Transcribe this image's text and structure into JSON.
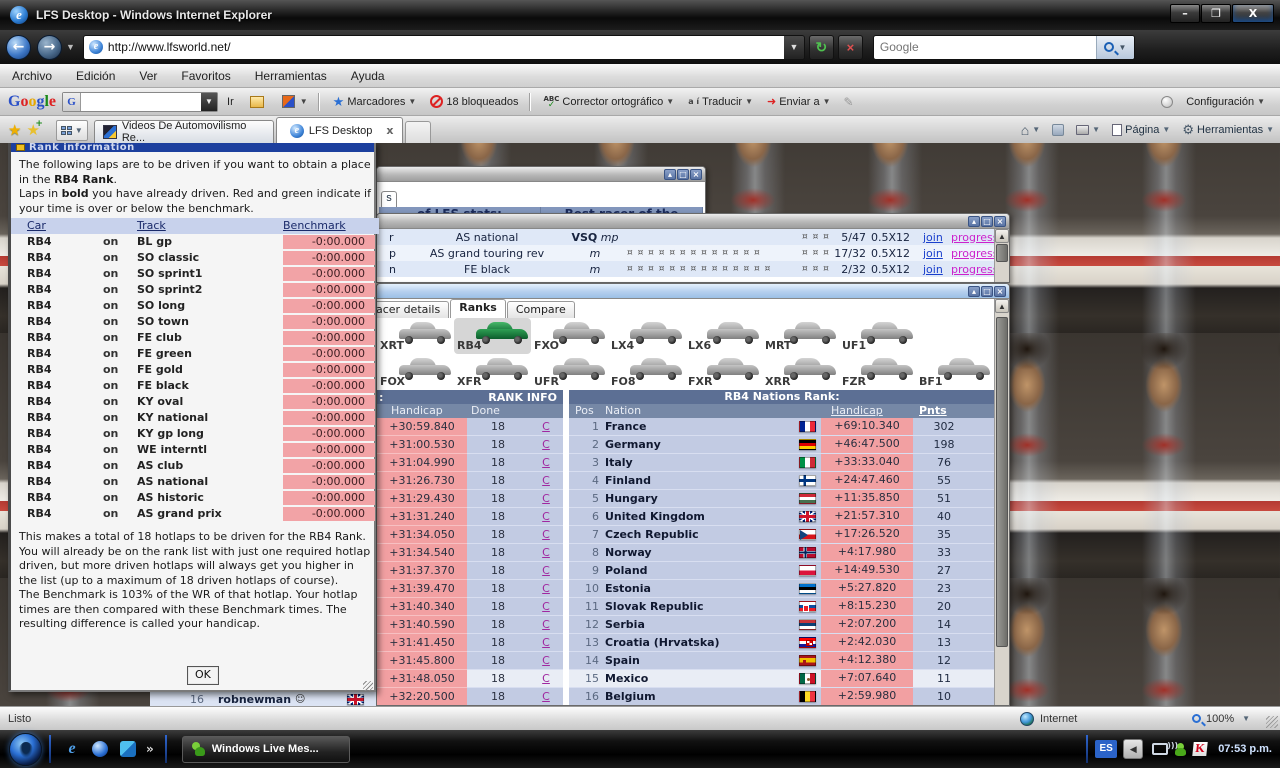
{
  "window": {
    "title": "LFS Desktop - Windows Internet Explorer"
  },
  "address_bar": {
    "url": "http://www.lfsworld.net/",
    "search_placeholder": "Google"
  },
  "menu_bar": {
    "items": [
      "Archivo",
      "Edición",
      "Ver",
      "Favoritos",
      "Herramientas",
      "Ayuda"
    ]
  },
  "google_toolbar": {
    "logo": "Google",
    "go_label": "Ir",
    "bookmarks_label": "Marcadores",
    "blocked_label": "18 bloqueados",
    "spellcheck_label": "Corrector ortográfico",
    "translate_label": "Traducir",
    "send_label": "Enviar a",
    "settings_label": "Configuración"
  },
  "tab_bar": {
    "tab1": "Videos De Automovilismo Re...",
    "tab2": "LFS Desktop",
    "close_glyph": "x",
    "page_label": "Página",
    "tools_label": "Herramientas"
  },
  "rank_info_panel": {
    "title": "Rank information",
    "intro1_pre": "The following laps are to be driven if you want to obtain a place in the ",
    "intro1_bold": "RB4 Rank",
    "intro1_post": ".",
    "intro2_pre": "Laps in ",
    "intro2_bold": "bold",
    "intro2_post": " you have already driven. Red and green indicate if your time is over or below the benchmark.",
    "table": {
      "headers": [
        "Car",
        "Track",
        "Benchmark"
      ],
      "on_word": "on",
      "rows": [
        {
          "car": "RB4",
          "track": "BL gp",
          "benchmark": "-0:00.000"
        },
        {
          "car": "RB4",
          "track": "SO classic",
          "benchmark": "-0:00.000"
        },
        {
          "car": "RB4",
          "track": "SO sprint1",
          "benchmark": "-0:00.000"
        },
        {
          "car": "RB4",
          "track": "SO sprint2",
          "benchmark": "-0:00.000"
        },
        {
          "car": "RB4",
          "track": "SO long",
          "benchmark": "-0:00.000"
        },
        {
          "car": "RB4",
          "track": "SO town",
          "benchmark": "-0:00.000"
        },
        {
          "car": "RB4",
          "track": "FE club",
          "benchmark": "-0:00.000"
        },
        {
          "car": "RB4",
          "track": "FE green",
          "benchmark": "-0:00.000"
        },
        {
          "car": "RB4",
          "track": "FE gold",
          "benchmark": "-0:00.000"
        },
        {
          "car": "RB4",
          "track": "FE black",
          "benchmark": "-0:00.000"
        },
        {
          "car": "RB4",
          "track": "KY oval",
          "benchmark": "-0:00.000"
        },
        {
          "car": "RB4",
          "track": "KY national",
          "benchmark": "-0:00.000"
        },
        {
          "car": "RB4",
          "track": "KY gp long",
          "benchmark": "-0:00.000"
        },
        {
          "car": "RB4",
          "track": "WE interntl",
          "benchmark": "-0:00.000"
        },
        {
          "car": "RB4",
          "track": "AS club",
          "benchmark": "-0:00.000"
        },
        {
          "car": "RB4",
          "track": "AS national",
          "benchmark": "-0:00.000"
        },
        {
          "car": "RB4",
          "track": "AS historic",
          "benchmark": "-0:00.000"
        },
        {
          "car": "RB4",
          "track": "AS grand prix",
          "benchmark": "-0:00.000"
        }
      ]
    },
    "footer1": "This makes a total of 18 hotlaps to be driven for the RB4 Rank. You will already be on the rank list with just one required hotlap driven, but more driven hotlaps will always get you higher in the list (up to a maximum of 18 driven hotlaps of course).",
    "footer2": "The Benchmark is 103% of the WR of that hotlap. Your hotlap times are then compared with these Benchmark times. The resulting difference is called your handicap.",
    "ok_label": "OK"
  },
  "stats_window": {
    "tab": "s",
    "header_left": "of LFS stats:",
    "header_right": "Best racer of the moment:"
  },
  "hosts_window": {
    "rows": [
      {
        "letter": "r",
        "track": "AS national",
        "code": "VSQ",
        "mode": "mp",
        "cars_a": "",
        "cars_b": "¤ ¤ ¤",
        "count": "5/47",
        "grid": "0.5X12",
        "join_label": "join",
        "progress_label": "progress"
      },
      {
        "letter": "p",
        "track": "AS grand touring rev",
        "code": "",
        "mode": "m",
        "cars_a": "¤ ¤ ¤ ¤ ¤ ¤ ¤ ¤ ¤ ¤ ¤  ¤ ¤",
        "cars_b": "¤ ¤ ¤",
        "count": "17/32",
        "grid": "0.5X12",
        "join_label": "join",
        "progress_label": "progress"
      },
      {
        "letter": "n",
        "track": "FE black",
        "code": "",
        "mode": "m",
        "cars_a": "¤ ¤ ¤ ¤ ¤ ¤ ¤ ¤ ¤ ¤ ¤ ¤ ¤ ¤",
        "cars_b": "¤ ¤ ¤",
        "count": "2/32",
        "grid": "0.5X12",
        "join_label": "join",
        "progress_label": "progress"
      }
    ]
  },
  "ranks_window": {
    "tabs": [
      "acer details",
      "Ranks",
      "Compare"
    ],
    "cars_top": [
      "XRT",
      "RB4",
      "FXO",
      "LX4",
      "LX6",
      "MRT",
      "UF1"
    ],
    "cars_bottom": [
      "FOX",
      "XFR",
      "UFR",
      "FO8",
      "FXR",
      "XRR",
      "FZR",
      "BF1"
    ],
    "selected_car": "RB4",
    "left_header_colon": ":",
    "left_header": "RANK INFO",
    "right_header": "RB4 Nations Rank:",
    "col_handicap_left": "Handicap",
    "col_done": "Done",
    "col_pos": "Pos",
    "col_nation": "Nation",
    "col_handicap_right": "Handicap",
    "col_pnts": "Pnts",
    "rows": [
      {
        "my_handicap": "+30:59.840",
        "done": "18",
        "c_label": "C",
        "pos": "1",
        "nation": "France",
        "flag": "fr",
        "handicap": "+69:10.340",
        "pnts": "302"
      },
      {
        "my_handicap": "+31:00.530",
        "done": "18",
        "c_label": "C",
        "pos": "2",
        "nation": "Germany",
        "flag": "de",
        "handicap": "+46:47.500",
        "pnts": "198"
      },
      {
        "my_handicap": "+31:04.990",
        "done": "18",
        "c_label": "C",
        "pos": "3",
        "nation": "Italy",
        "flag": "it",
        "handicap": "+33:33.040",
        "pnts": "76"
      },
      {
        "my_handicap": "+31:26.730",
        "done": "18",
        "c_label": "C",
        "pos": "4",
        "nation": "Finland",
        "flag": "fi",
        "handicap": "+24:47.460",
        "pnts": "55"
      },
      {
        "my_handicap": "+31:29.430",
        "done": "18",
        "c_label": "C",
        "pos": "5",
        "nation": "Hungary",
        "flag": "hu",
        "handicap": "+11:35.850",
        "pnts": "51"
      },
      {
        "my_handicap": "+31:31.240",
        "done": "18",
        "c_label": "C",
        "pos": "6",
        "nation": "United Kingdom",
        "flag": "gb",
        "handicap": "+21:57.310",
        "pnts": "40"
      },
      {
        "my_handicap": "+31:34.050",
        "done": "18",
        "c_label": "C",
        "pos": "7",
        "nation": "Czech Republic",
        "flag": "cz",
        "handicap": "+17:26.520",
        "pnts": "35"
      },
      {
        "my_handicap": "+31:34.540",
        "done": "18",
        "c_label": "C",
        "pos": "8",
        "nation": "Norway",
        "flag": "no",
        "handicap": "+4:17.980",
        "pnts": "33"
      },
      {
        "my_handicap": "+31:37.370",
        "done": "18",
        "c_label": "C",
        "pos": "9",
        "nation": "Poland",
        "flag": "pl",
        "handicap": "+14:49.530",
        "pnts": "27"
      },
      {
        "my_handicap": "+31:39.470",
        "done": "18",
        "c_label": "C",
        "pos": "10",
        "nation": "Estonia",
        "flag": "ee",
        "handicap": "+5:27.820",
        "pnts": "23"
      },
      {
        "my_handicap": "+31:40.340",
        "done": "18",
        "c_label": "C",
        "pos": "11",
        "nation": "Slovak Republic",
        "flag": "sk",
        "handicap": "+8:15.230",
        "pnts": "20"
      },
      {
        "my_handicap": "+31:40.590",
        "done": "18",
        "c_label": "C",
        "pos": "12",
        "nation": "Serbia",
        "flag": "rs",
        "handicap": "+2:07.200",
        "pnts": "14"
      },
      {
        "my_handicap": "+31:41.450",
        "done": "18",
        "c_label": "C",
        "pos": "13",
        "nation": "Croatia (Hrvatska)",
        "flag": "hr",
        "handicap": "+2:42.030",
        "pnts": "13"
      },
      {
        "my_handicap": "+31:45.800",
        "done": "18",
        "c_label": "C",
        "pos": "14",
        "nation": "Spain",
        "flag": "es",
        "handicap": "+4:12.380",
        "pnts": "12"
      },
      {
        "my_handicap": "+31:48.050",
        "done": "18",
        "c_label": "C",
        "pos": "15",
        "nation": "Mexico",
        "flag": "mx",
        "handicap": "+7:07.640",
        "pnts": "11"
      },
      {
        "my_handicap": "+32:20.500",
        "done": "18",
        "c_label": "C",
        "pos": "16",
        "nation": "Belgium",
        "flag": "be",
        "handicap": "+2:59.980",
        "pnts": "10"
      }
    ]
  },
  "behind_row": {
    "pos": "16",
    "name": "robnewman",
    "badge": "☺"
  },
  "status_bar": {
    "status": "Listo",
    "zone": "Internet",
    "zoom": "100%"
  },
  "taskbar": {
    "task_label": "Windows Live Mes...",
    "more_glyph": "»",
    "lang": "ES",
    "clock": "07:53 p.m."
  },
  "icons": {
    "min": "–",
    "restore": "❐",
    "close": "X",
    "win_shade": "▴",
    "win_restore": "□",
    "win_close": "×",
    "back": "←",
    "forward": "→",
    "refresh": "↻",
    "stop": "×",
    "star": "★",
    "home": "⌂",
    "gear": "⚙",
    "dropdown": "▼",
    "up_arrow": "▲",
    "left_arrow": "◀"
  }
}
